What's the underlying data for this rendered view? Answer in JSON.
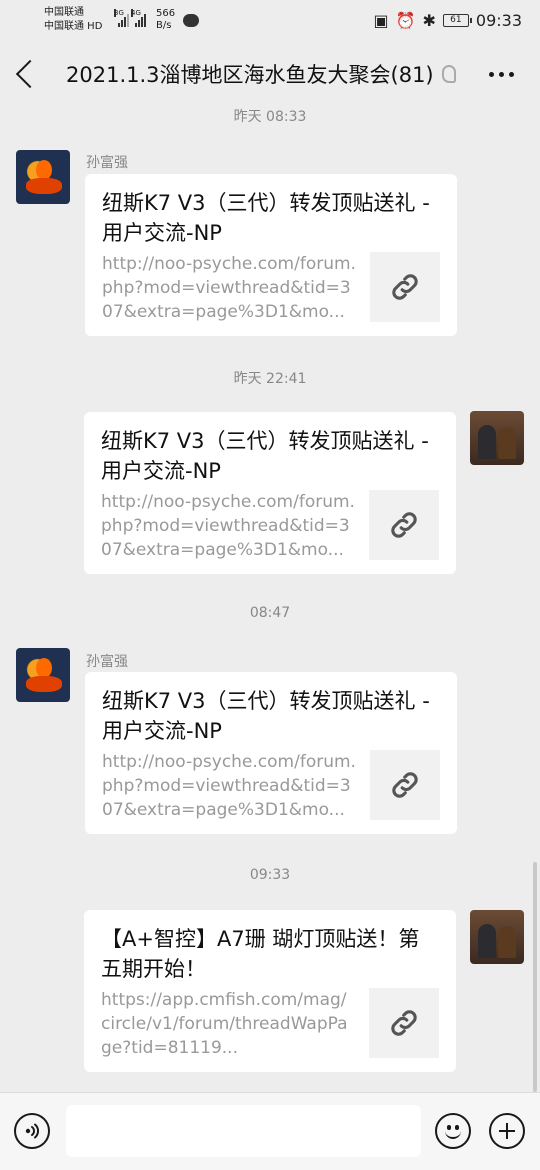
{
  "status_bar": {
    "carrier_1": "中国联通",
    "carrier_2": "中国联通 HD",
    "net_1": "3G",
    "net_2": "4G",
    "speed_value": "566",
    "speed_unit": "B/s",
    "battery": "61",
    "time": "09:33"
  },
  "nav": {
    "title": "2021.1.3淄博地区海水鱼友大聚会(81)"
  },
  "messages": [
    {
      "time": "昨天 08:33",
      "sender": "孙富强",
      "side": "left",
      "title": "纽斯K7 V3（三代）转发顶贴送礼 - 用户交流-NP",
      "url": "http://noo-psyche.com/forum.php?mod=viewthread&tid=307&extra=page%3D1&mo..."
    },
    {
      "time": "昨天 22:41",
      "sender": "",
      "side": "right",
      "title": "纽斯K7 V3（三代）转发顶贴送礼 - 用户交流-NP",
      "url": "http://noo-psyche.com/forum.php?mod=viewthread&tid=307&extra=page%3D1&mo..."
    },
    {
      "time": "08:47",
      "sender": "孙富强",
      "side": "left",
      "title": "纽斯K7 V3（三代）转发顶贴送礼 - 用户交流-NP",
      "url": "http://noo-psyche.com/forum.php?mod=viewthread&tid=307&extra=page%3D1&mo..."
    },
    {
      "time": "09:33",
      "sender": "",
      "side": "right",
      "title": "【A+智控】A7珊 瑚灯顶贴送！第五期开始！",
      "url": "https://app.cmfish.com/mag/circle/v1/forum/threadWapPage?tid=81119..."
    }
  ],
  "icons": {
    "back": "chevron-left-icon",
    "more": "more-dots-icon",
    "voice": "voice-icon",
    "emoji": "emoji-icon",
    "plus": "plus-icon",
    "link": "link-icon"
  }
}
